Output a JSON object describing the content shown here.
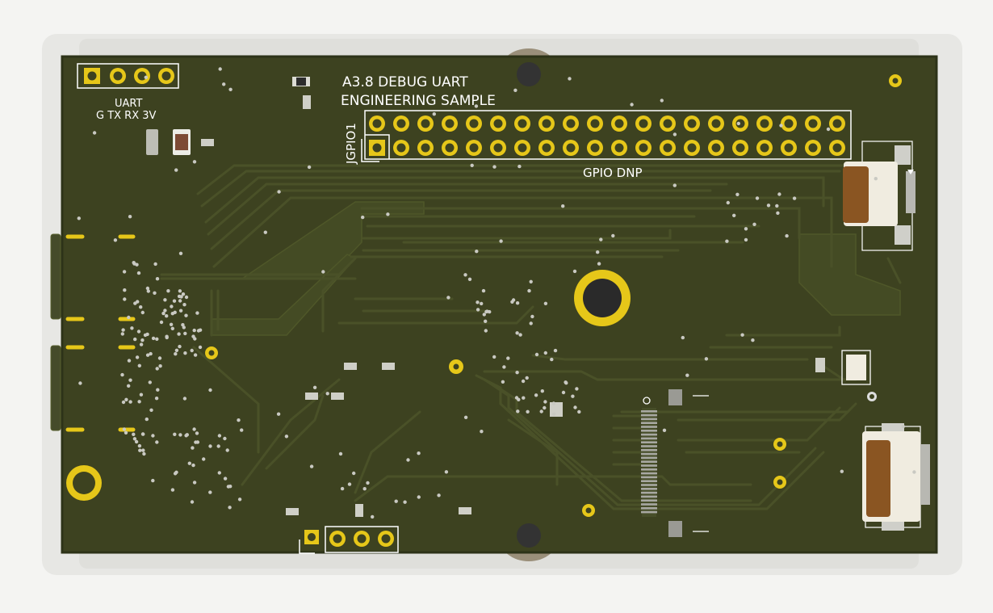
{
  "board": {
    "title_line1": "A3.8 DEBUG UART",
    "title_line2": "ENGINEERING SAMPLE",
    "uart_label": "UART",
    "uart_pins": "G TX RX 3V",
    "gpio_ref": "JGPIO1",
    "gpio_label": "GPIO DNP",
    "gpio_columns": 20,
    "gpio_rows": 2
  },
  "colors": {
    "background": "#f4f4f2",
    "pcb_mask": "#3d4220",
    "pcb_edge": "#2d3318",
    "copper_trace": "#4a5128",
    "silkscreen": "#ffffff",
    "pad_gold": "#e6c719",
    "connector_body": "#f0ece0",
    "connector_slider": "#8a5522",
    "standoff": "#9a8f7a"
  },
  "icons": {
    "mounting_hole": "mounting-hole-icon",
    "pad": "gold-pad-icon",
    "usb_c": "usb-c-connector-icon",
    "fpc": "fpc-connector-icon"
  }
}
